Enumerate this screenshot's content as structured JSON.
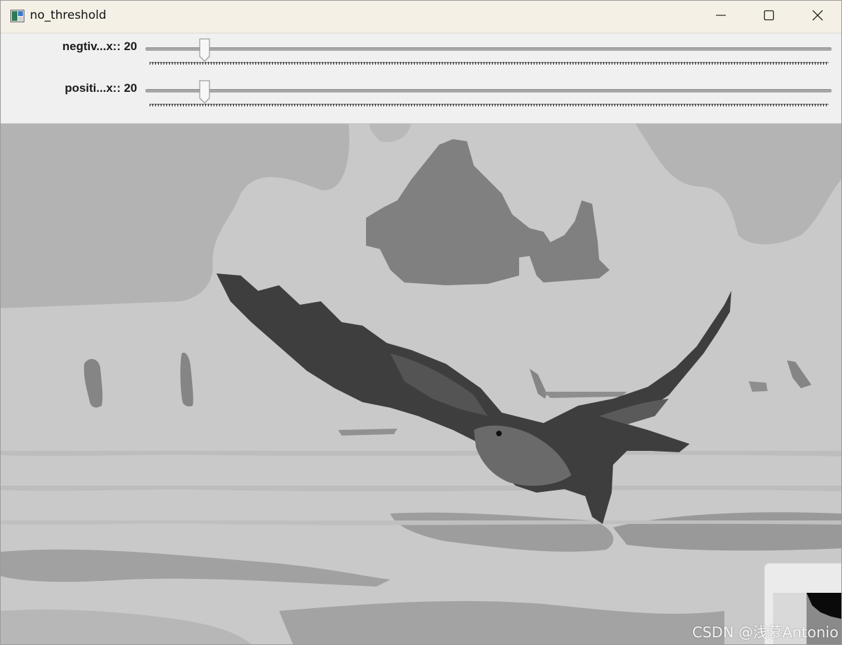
{
  "window": {
    "title": "no_threshold",
    "icon": "app-window-icon"
  },
  "titlebar_buttons": {
    "minimize": "minimize-icon",
    "maximize": "maximize-icon",
    "close": "close-icon"
  },
  "trackbars": [
    {
      "label": "negtiv...x:: 20",
      "value": 20,
      "fraction": 0.086
    },
    {
      "label": "positi...x:: 20",
      "value": 20,
      "fraction": 0.086
    }
  ],
  "image": {
    "content": "grayscale-hawk-over-water"
  },
  "watermark": "CSDN @浅慕Antonio"
}
